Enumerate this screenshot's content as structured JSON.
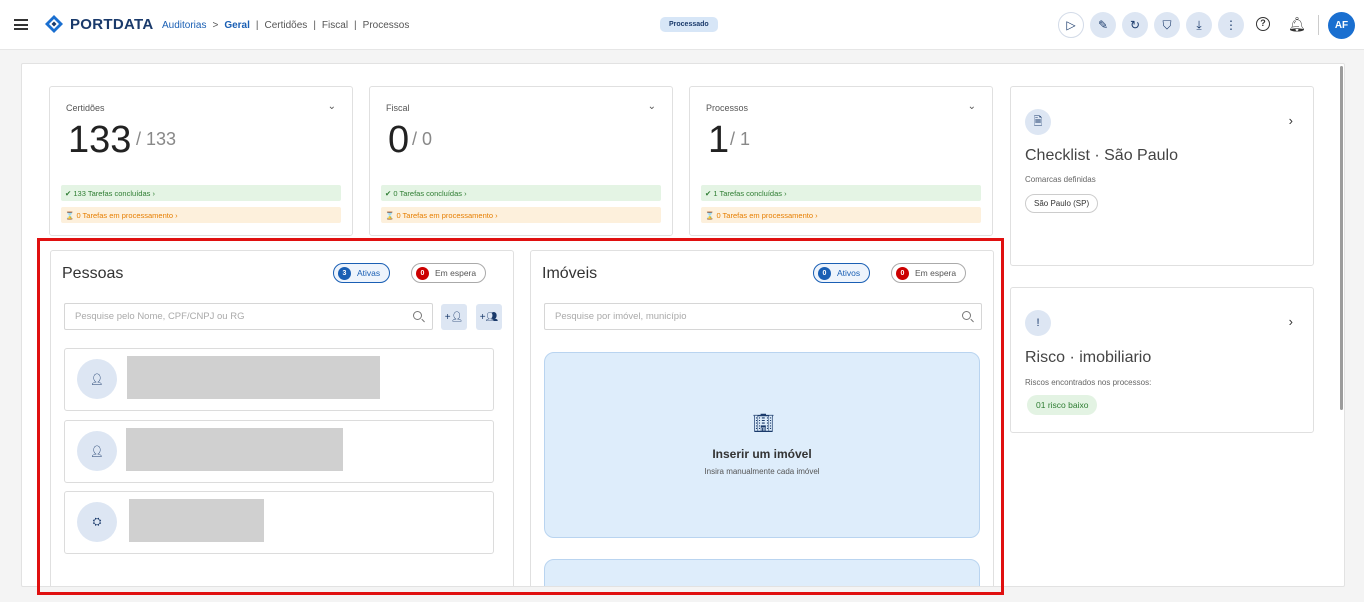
{
  "header": {
    "logo_text": "PORTDATA",
    "breadcrumb": [
      {
        "label": "Auditorias"
      },
      {
        "sep": ">"
      },
      {
        "label": "Geral"
      },
      {
        "sep": "|"
      },
      {
        "label": "Certidões"
      },
      {
        "sep": "|"
      },
      {
        "label": "Fiscal"
      },
      {
        "sep": "|"
      },
      {
        "label": "Processos"
      }
    ],
    "status": "Processado",
    "avatar_initials": "AF",
    "icons": [
      "play-icon",
      "edit-icon",
      "refresh-icon",
      "shield-icon",
      "download-icon",
      "more-icon"
    ]
  },
  "stats": [
    {
      "label": "Certidões",
      "value": "133",
      "total": "/ 133",
      "done": "133 Tarefas concluídas",
      "processing": "0 Tarefas em processamento"
    },
    {
      "label": "Fiscal",
      "value": "0",
      "total": "/ 0",
      "done": "0 Tarefas concluídas",
      "processing": "0 Tarefas em processamento"
    },
    {
      "label": "Processos",
      "value": "1",
      "total": "/ 1",
      "done": "1 Tarefas concluídas",
      "processing": "0 Tarefas em processamento"
    }
  ],
  "checklist": {
    "title": "Checklist · São Paulo",
    "subtitle": "Comarcas definidas",
    "chip": "São Paulo (SP)"
  },
  "risk": {
    "title": "Risco · imobiliario",
    "subtitle": "Riscos encontrados nos processos:",
    "chip": "01 risco baixo"
  },
  "pessoas": {
    "title": "Pessoas",
    "active_count": "3",
    "active_label": "Ativas",
    "waiting_count": "0",
    "waiting_label": "Em espera",
    "search_placeholder": "Pesquise pelo Nome, CPF/CNPJ ou RG",
    "items": [
      {
        "icon": "person-icon"
      },
      {
        "icon": "person-icon"
      },
      {
        "icon": "company-icon"
      }
    ]
  },
  "imoveis": {
    "title": "Imóveis",
    "active_count": "0",
    "active_label": "Ativos",
    "waiting_count": "0",
    "waiting_label": "Em espera",
    "search_placeholder": "Pesquise por imóvel, município",
    "insert_title": "Inserir um imóvel",
    "insert_subtitle": "Insira manualmente cada imóvel"
  }
}
